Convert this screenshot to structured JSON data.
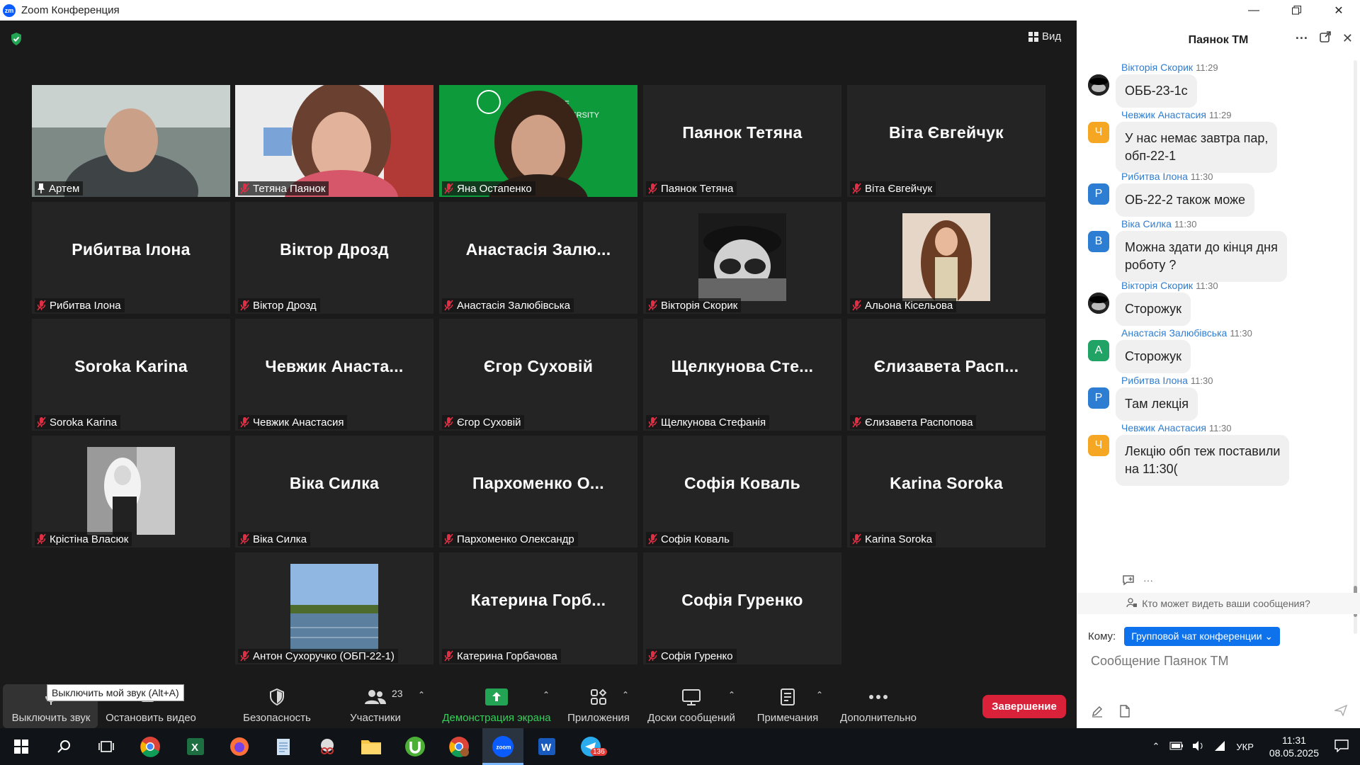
{
  "window": {
    "title": "Zoom Конференция",
    "logo": "zm"
  },
  "meeting": {
    "view_label": "Вид",
    "tiles": [
      {
        "big": "",
        "name": "Артем",
        "active": true,
        "pinned": true,
        "video": "man"
      },
      {
        "big": "",
        "name": "Тетяна Паянок",
        "video": "woman-office"
      },
      {
        "big": "",
        "name": "Яна Остапенко",
        "video": "woman-green"
      },
      {
        "big": "Паянок Тетяна",
        "name": "Паянок Тетяна"
      },
      {
        "big": "Віта Євгейчук",
        "name": "Віта Євгейчук"
      },
      {
        "big": "Рибитва Ілона",
        "name": "Рибитва Ілона"
      },
      {
        "big": "Віктор Дрозд",
        "name": "Віктор Дрозд"
      },
      {
        "big": "Анастасія Залю...",
        "name": "Анастасія Залюбівська"
      },
      {
        "big": "",
        "name": "Вікторія Скорик",
        "photo": "anime"
      },
      {
        "big": "",
        "name": "Альона Кісельова",
        "photo": "girl"
      },
      {
        "big": "Soroka Karina",
        "name": "Soroka Karina"
      },
      {
        "big": "Чевжик Анаста...",
        "name": "Чевжик Анастасия"
      },
      {
        "big": "Єгор Суховій",
        "name": "Єгор Суховій"
      },
      {
        "big": "Щелкунова Сте...",
        "name": "Щелкунова Стефанія"
      },
      {
        "big": "Єлизавета Расп...",
        "name": "Єлизавета Распопова"
      },
      {
        "big": "",
        "name": "Крістіна Власюк",
        "photo": "bw"
      },
      {
        "big": "Віка Силка",
        "name": "Віка Силка"
      },
      {
        "big": "Пархоменко О...",
        "name": "Пархоменко Олександр"
      },
      {
        "big": "Софія Коваль",
        "name": "Софія Коваль"
      },
      {
        "big": "Karina Soroka",
        "name": "Karina Soroka"
      },
      {
        "big": "",
        "name": "Антон Сухоручко (ОБП-22-1)",
        "photo": "lake"
      },
      {
        "big": "Катерина Горб...",
        "name": "Катерина Горбачова"
      },
      {
        "big": "Софія Гуренко",
        "name": "Софія Гуренко"
      }
    ]
  },
  "toolbar": {
    "tooltip": "Выключить мой звук (Alt+A)",
    "mute": "Выключить звук",
    "video": "Остановить видео",
    "security": "Безопасность",
    "participants": "Участники",
    "participants_count": "23",
    "share": "Демонстрация экрана",
    "apps": "Приложения",
    "whiteboards": "Доски сообщений",
    "notes": "Примечания",
    "more": "Дополнительно",
    "end": "Завершение"
  },
  "chat": {
    "title": "Паянок ТМ",
    "messages": [
      {
        "name": "Вікторія Скорик",
        "time": "11:29",
        "text": [
          "ОББ-23-1с"
        ],
        "avatar": "",
        "avatar_color": "#222222",
        "avatar_img": true
      },
      {
        "name": "Чевжик Анастасия",
        "time": "11:29",
        "text": [
          "У нас немає завтра пар,",
          "обп-22-1"
        ],
        "avatar": "Ч",
        "avatar_color": "#f5a623"
      },
      {
        "name": "Рибитва Ілона",
        "time": "11:30",
        "text": [
          "ОБ-22-2 також може"
        ],
        "avatar": "Р",
        "avatar_color": "#2d7dd2"
      },
      {
        "name": "Віка Силка",
        "time": "11:30",
        "text": [
          "Можна здати до кінця дня",
          "роботу ?"
        ],
        "avatar": "В",
        "avatar_color": "#2d7dd2"
      },
      {
        "name": "Вікторія Скорик",
        "time": "11:30",
        "text": [
          "Сторожук"
        ],
        "avatar": "",
        "avatar_color": "#222222",
        "avatar_img": true
      },
      {
        "name": "Анастасія Залюбівська",
        "time": "11:30",
        "text": [
          "Сторожук"
        ],
        "avatar": "А",
        "avatar_color": "#21a366"
      },
      {
        "name": "Рибитва Ілона",
        "time": "11:30",
        "text": [
          "Там лекція"
        ],
        "avatar": "Р",
        "avatar_color": "#2d7dd2"
      },
      {
        "name": "Чевжик Анастасия",
        "time": "11:30",
        "text": [
          "Лекцію обп теж поставили",
          "на 11:30("
        ],
        "avatar": "Ч",
        "avatar_color": "#f5a623"
      }
    ],
    "who_can_see": "Кто может видеть ваши сообщения?",
    "to_label": "Кому:",
    "to_value": "Групповой чат конференции",
    "input_placeholder": "Сообщение Паянок ТМ"
  },
  "taskbar": {
    "lang": "УКР",
    "time": "11:31",
    "date": "08.05.2025",
    "telegram_badge": "136"
  }
}
